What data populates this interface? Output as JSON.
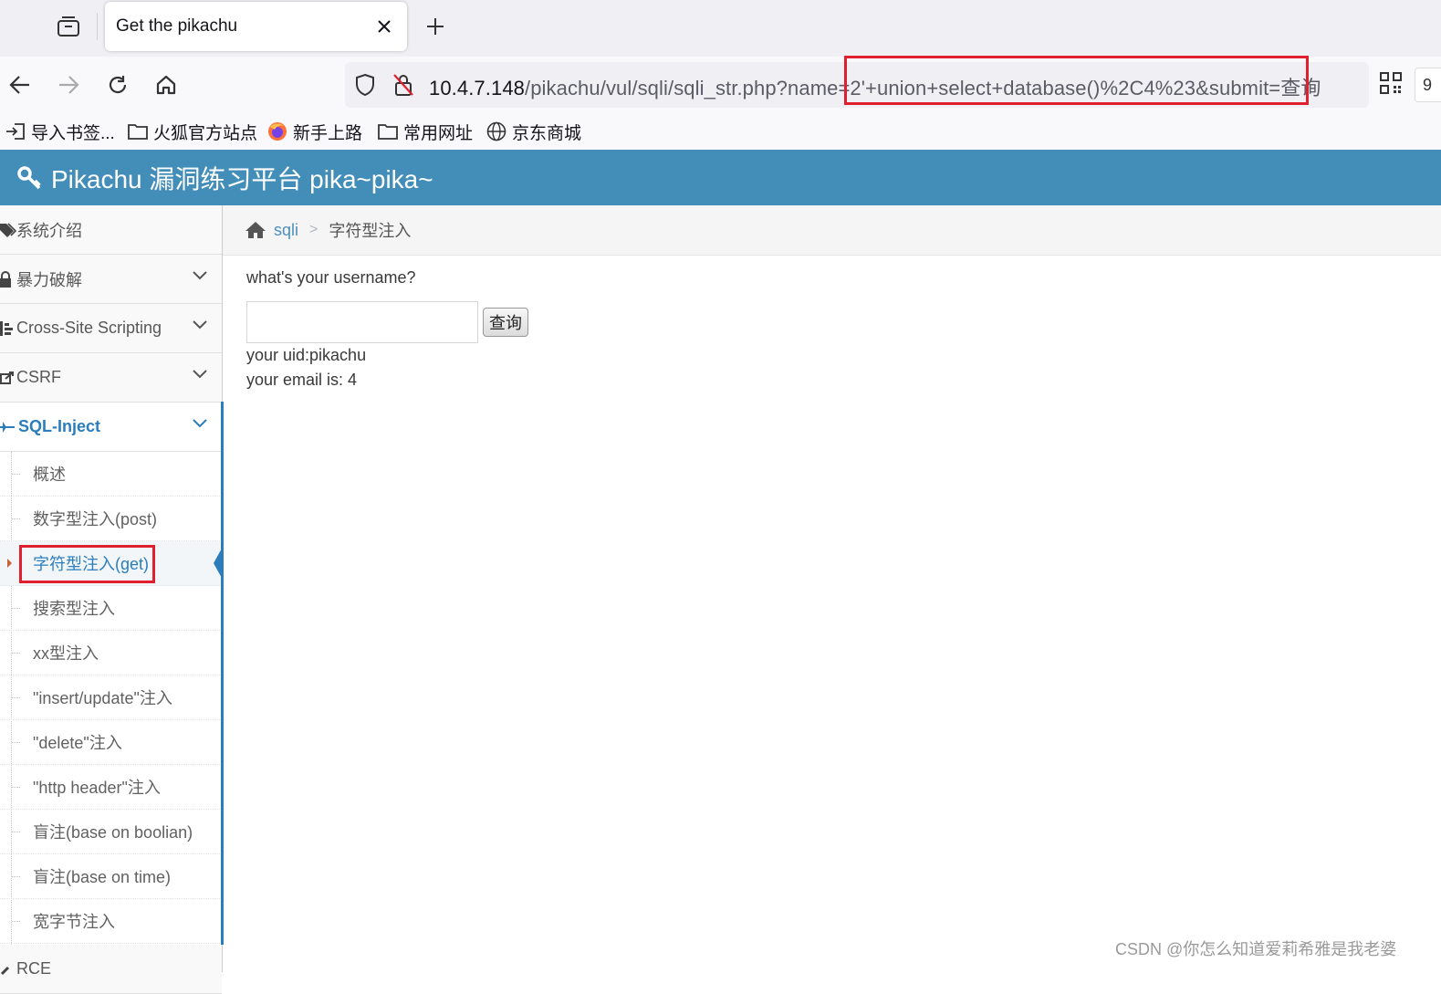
{
  "browser": {
    "tab": {
      "title": "Get the pikachu"
    },
    "url": {
      "host": "10.4.7.148",
      "path": "/pikachu/vul/sqli/sqli_str.php?name=2'+union+select+database()%2C4%23&submit=查询"
    },
    "ext_partial": "9",
    "bookmarks": [
      {
        "icon": "import-icon",
        "label": "导入书签..."
      },
      {
        "icon": "folder-icon",
        "label": "火狐官方站点"
      },
      {
        "icon": "firefox-icon",
        "label": "新手上路"
      },
      {
        "icon": "folder-icon",
        "label": "常用网址"
      },
      {
        "icon": "globe-icon",
        "label": "京东商城"
      }
    ]
  },
  "site": {
    "title": "Pikachu 漏洞练习平台 pika~pika~",
    "accent": "#438eb9"
  },
  "sidebar": {
    "items": [
      {
        "label": "系统介绍",
        "icon": "tags-icon"
      },
      {
        "label": "暴力破解",
        "icon": "lock-icon"
      },
      {
        "label": "Cross-Site Scripting",
        "icon": "list-icon"
      },
      {
        "label": "CSRF",
        "icon": "share-icon"
      },
      {
        "label": "SQL-Inject",
        "icon": "plane-icon"
      }
    ],
    "subitems": [
      "概述",
      "数字型注入(post)",
      "字符型注入(get)",
      "搜索型注入",
      "xx型注入",
      "\"insert/update\"注入",
      "\"delete\"注入",
      "\"http header\"注入",
      "盲注(base on boolian)",
      "盲注(base on time)",
      "宽字节注入"
    ],
    "next_partial": "RCE"
  },
  "breadcrumb": {
    "link": "sqli",
    "current": "字符型注入"
  },
  "main": {
    "prompt": "what's your username?",
    "input_value": "",
    "button_label": "查询",
    "result_uid": "your uid:pikachu",
    "result_email": "your email is: 4"
  },
  "watermark": "CSDN @你怎么知道爱莉希雅是我老婆"
}
